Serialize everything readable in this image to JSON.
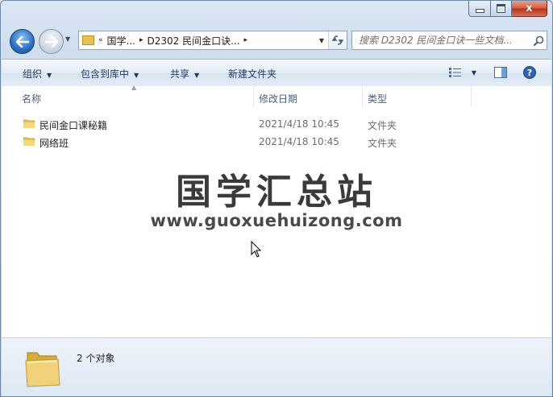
{
  "window": {
    "caption": {
      "min_glyph": "",
      "max_glyph": "",
      "close_glyph": "x"
    }
  },
  "nav": {
    "back_icon": "arrow-left-icon",
    "forward_icon": "arrow-right-icon"
  },
  "address": {
    "overflow": "«",
    "crumbs": [
      "国学...",
      "D2302 民间金口诀..."
    ],
    "sep": "▸"
  },
  "search": {
    "placeholder": "搜索 D2302 民间金口诀一些文档..."
  },
  "toolbar": {
    "organize": "组织",
    "include_in_library": "包含到库中",
    "share": "共享",
    "new_folder": "新建文件夹"
  },
  "columns": {
    "name": "名称",
    "modified": "修改日期",
    "type": "类型"
  },
  "files": [
    {
      "name": "民间金口课秘籍",
      "modified": "2021/4/18 10:45",
      "type": "文件夹"
    },
    {
      "name": "网络班",
      "modified": "2021/4/18 10:45",
      "type": "文件夹"
    }
  ],
  "watermark": {
    "title": "国学汇总站",
    "url": "www.guoxuehuizong.com"
  },
  "details": {
    "status": "2 个对象"
  },
  "colors": {
    "folder": "#e8c257",
    "accent": "#1e395b"
  }
}
